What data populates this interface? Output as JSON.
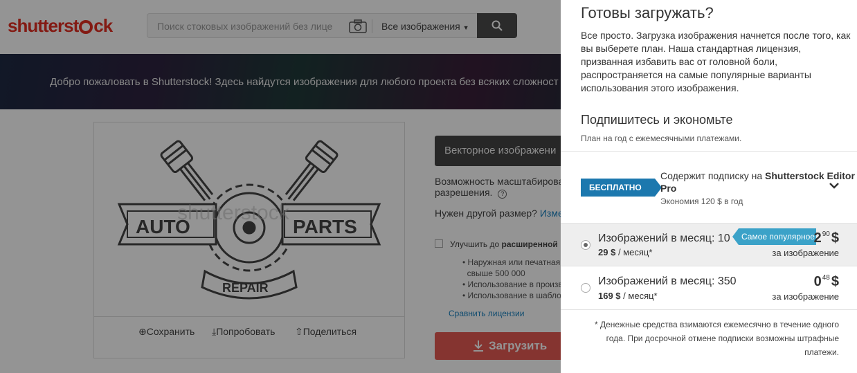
{
  "header": {
    "logo_text": "shutterstock",
    "search": {
      "placeholder": "Поиск стоковых изображений без лице",
      "category": "Все изображения"
    }
  },
  "banner": {
    "text": "Добро пожаловать в Shutterstock! Здесь найдутся изображения для любого проекта без всяких сложност"
  },
  "image": {
    "words": {
      "left": "AUTO",
      "right": "PARTS",
      "bottom": "REPAIR"
    },
    "watermark": "shutterstock",
    "actions": {
      "save": "Сохранить",
      "try": "Попробовать",
      "share": "Поделиться"
    }
  },
  "details": {
    "vector_label": "Векторное изображени",
    "scalable_line1": "Возможность масштабирова",
    "scalable_line2": "разрешения.",
    "help_icon": "?",
    "other_size": "Нужен другой размер?",
    "other_size_link": "Изме",
    "upgrade_prefix": "Улучшить до",
    "upgrade_bold": "расширенной",
    "bullets": [
      "Наружная или печатная р",
      "свыше 500 000",
      "Использование в произво",
      "Использование в шаблон"
    ],
    "compare_link": "Сравнить лицензии",
    "download_button": "Загрузить"
  },
  "panel": {
    "title": "Готовы загружать?",
    "description": "Все просто. Загрузка изображения начнется после того, как вы выберете план. Наша стандартная лицензия, призванная избавить вас от головной боли, распространяется на самые популярные варианты использования этого изображения.",
    "subscribe_title": "Подпишитесь и экономьте",
    "subscribe_note": "План на год с ежемесячными платежами.",
    "free_badge": "БЕСПЛАТНО",
    "editor_prefix": "Содержит подписку на ",
    "editor_name": "Shutterstock Editor Pro",
    "editor_savings": "Экономия 120 $ в год",
    "plans": [
      {
        "name": "Изображений в месяц: 10",
        "monthly_price": "29 $",
        "monthly_suffix": "/ месяц*",
        "per_image_int": "2",
        "per_image_dec": "90",
        "currency": "$",
        "per_image_label": "за изображение",
        "badge": "Самое популярное",
        "selected": true
      },
      {
        "name": "Изображений в месяц: 350",
        "monthly_price": "169 $",
        "monthly_suffix": "/ месяц*",
        "per_image_int": "0",
        "per_image_dec": "48",
        "currency": "$",
        "per_image_label": "за изображение",
        "selected": false
      }
    ],
    "footnote": "* Денежные средства взимаются ежемесячно в течение одного года. При досрочной отмене подписки возможны штрафные платежи."
  },
  "colors": {
    "brand_red": "#e22e22",
    "badge_blue": "#1c78ae",
    "popular_blue": "#3ba2c8",
    "download_red": "#e55a54"
  }
}
